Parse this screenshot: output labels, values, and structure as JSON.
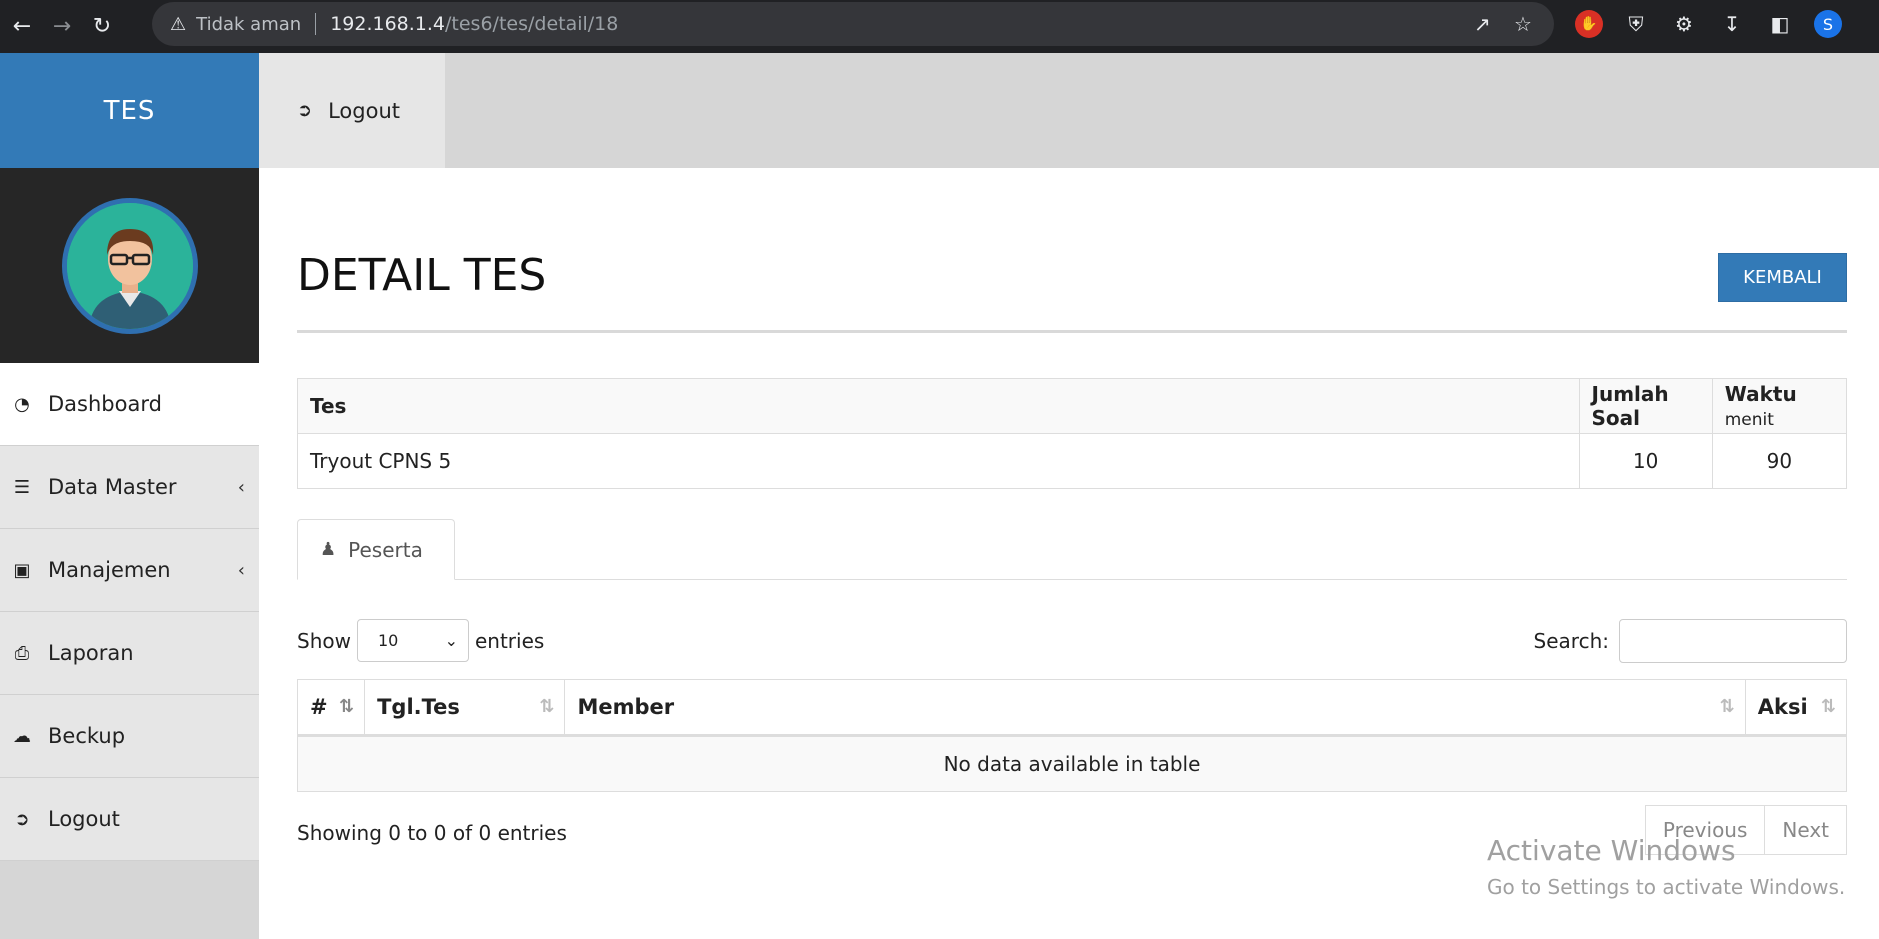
{
  "browser": {
    "security_label": "Tidak aman",
    "url_host": "192.168.1.4",
    "url_path": "/tes6/tes/detail/18",
    "profile_initial": "S"
  },
  "sidebar": {
    "brand": "TES",
    "items": [
      {
        "label": "Dashboard",
        "icon": "dashboard-icon"
      },
      {
        "label": "Data Master",
        "icon": "bars-icon"
      },
      {
        "label": "Manajemen",
        "icon": "briefcase-icon"
      },
      {
        "label": "Laporan",
        "icon": "print-icon"
      },
      {
        "label": "Beckup",
        "icon": "cloud-download-icon"
      },
      {
        "label": "Logout",
        "icon": "sign-out-icon"
      }
    ]
  },
  "topbar": {
    "logout_label": "Logout"
  },
  "main": {
    "title": "DETAIL TES",
    "back_label": "KEMBALI",
    "info_table": {
      "headers": {
        "tes": "Tes",
        "jumlah_soal": "Jumlah Soal",
        "waktu": "Waktu",
        "waktu_unit": "menit"
      },
      "row": {
        "tes": "Tryout CPNS 5",
        "jumlah_soal": "10",
        "waktu": "90"
      }
    },
    "tab_label": "Peserta",
    "show_label": "Show",
    "entries_value": "10",
    "entries_label": "entries",
    "search_label": "Search:",
    "data_table": {
      "headers": [
        "#",
        "Tgl.Tes",
        "Member",
        "Aksi"
      ],
      "empty_text": "No data available in table"
    },
    "showing_text": "Showing 0 to 0 of 0 entries",
    "pager": {
      "previous": "Previous",
      "next": "Next"
    }
  },
  "watermark": {
    "line1": "Activate Windows",
    "line2": "Go to Settings to activate Windows."
  }
}
